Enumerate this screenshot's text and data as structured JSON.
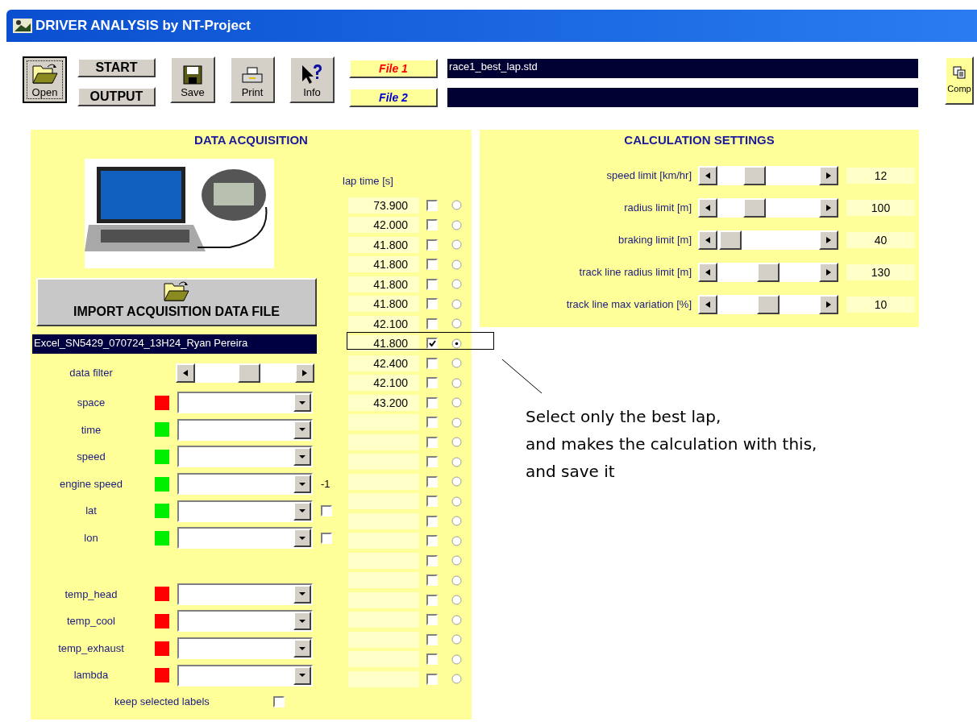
{
  "window": {
    "title": "DRIVER ANALYSIS by NT-Project"
  },
  "toolbar": {
    "open": {
      "label": "Open",
      "focused": true
    },
    "run_buttons": [
      "START",
      "OUTPUT"
    ],
    "tools": [
      {
        "kind": "save",
        "label": "Save"
      },
      {
        "kind": "print",
        "label": "Print"
      },
      {
        "kind": "info",
        "label": "Info"
      }
    ],
    "files": [
      {
        "label": "File 1",
        "color": "#ff0000",
        "path": "race1_best_lap.std"
      },
      {
        "label": "File 2",
        "color": "#0000cc"
      }
    ],
    "compare": {
      "label": "Comp"
    }
  },
  "data_acquisition": {
    "title": "DATA ACQUISITION",
    "import_button": "IMPORT ACQUISITION DATA FILE",
    "file_name": "Excel_SN5429_070724_13H24_Ryan Pereira",
    "filter": {
      "label": "data filter",
      "level": 0.55
    },
    "channel_groups": [
      [
        {
          "name": "space",
          "color": "#ff0000"
        },
        {
          "name": "time",
          "color": "#00ee00"
        },
        {
          "name": "speed",
          "color": "#00ee00"
        },
        {
          "name": "engine speed",
          "color": "#00ee00",
          "kind": "value",
          "value": "-1"
        },
        {
          "name": "lat",
          "color": "#00ee00",
          "kind": "checkbox",
          "checked": false
        },
        {
          "name": "lon",
          "color": "#00ee00",
          "kind": "checkbox",
          "checked": false
        }
      ],
      [
        {
          "name": "temp_head",
          "color": "#ff0000"
        },
        {
          "name": "temp_cool",
          "color": "#ff0000"
        },
        {
          "name": "temp_exhaust",
          "color": "#ff0000"
        },
        {
          "name": "lambda",
          "color": "#ff0000"
        }
      ]
    ],
    "keep_labels": {
      "label": "keep selected labels",
      "checked": false
    }
  },
  "laps": {
    "header": "lap time [s]",
    "rows": [
      {
        "time": "73.900",
        "checked": false,
        "selected": false
      },
      {
        "time": "42.000",
        "checked": false,
        "selected": false
      },
      {
        "time": "41.800",
        "checked": false,
        "selected": false
      },
      {
        "time": "41.800",
        "checked": false,
        "selected": false
      },
      {
        "time": "41.800",
        "checked": false,
        "selected": false
      },
      {
        "time": "41.800",
        "checked": false,
        "selected": false
      },
      {
        "time": "42.100",
        "checked": false,
        "selected": false
      },
      {
        "time": "41.800",
        "checked": true,
        "selected": true
      },
      {
        "time": "42.400",
        "checked": false,
        "selected": false
      },
      {
        "time": "42.100",
        "checked": false,
        "selected": false
      },
      {
        "time": "43.200",
        "checked": false,
        "selected": false
      },
      {
        "checked": false,
        "selected": false
      },
      {
        "checked": false,
        "selected": false
      },
      {
        "checked": false,
        "selected": false
      },
      {
        "checked": false,
        "selected": false
      },
      {
        "checked": false,
        "selected": false
      },
      {
        "checked": false,
        "selected": false
      },
      {
        "checked": false,
        "selected": false
      },
      {
        "checked": false,
        "selected": false
      },
      {
        "checked": false,
        "selected": false
      },
      {
        "checked": false,
        "selected": false
      },
      {
        "checked": false,
        "selected": false
      },
      {
        "checked": false,
        "selected": false
      },
      {
        "checked": false,
        "selected": false
      },
      {
        "checked": false,
        "selected": false
      }
    ]
  },
  "calculation_settings": {
    "title": "CALCULATION SETTINGS",
    "settings": [
      {
        "label": "speed limit [km/hr]",
        "level": 0.33,
        "reading": "12"
      },
      {
        "label": "radius limit [m]",
        "level": 0.33,
        "reading": "100"
      },
      {
        "label": "braking limit [m]",
        "level": 0.02,
        "reading": "40"
      },
      {
        "label": "track line radius limit [m]",
        "level": 0.5,
        "reading": "130"
      },
      {
        "label": "track line max variation [%]",
        "level": 0.5,
        "reading": "10"
      }
    ]
  },
  "annotation": {
    "lines": [
      "Select only the best lap,",
      "and makes the calculation with this,",
      "and save it"
    ]
  }
}
